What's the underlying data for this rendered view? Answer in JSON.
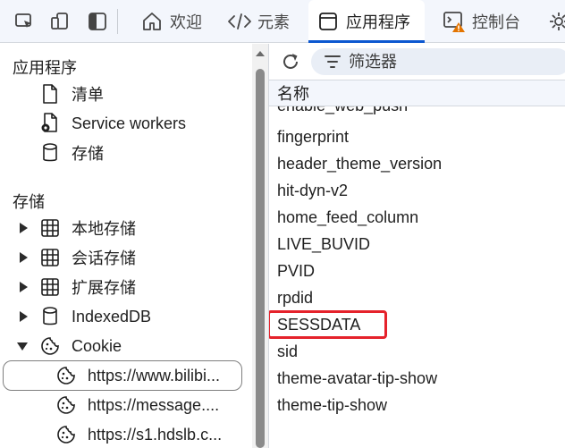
{
  "toolbar": {
    "tabs": [
      {
        "label": "欢迎"
      },
      {
        "label": "元素"
      },
      {
        "label": "应用程序"
      },
      {
        "label": "控制台"
      }
    ]
  },
  "sidebar": {
    "app_section_title": "应用程序",
    "app_items": [
      {
        "label": "清单",
        "icon": "document-icon"
      },
      {
        "label": "Service workers",
        "icon": "gear-document-icon"
      },
      {
        "label": "存储",
        "icon": "database-icon"
      }
    ],
    "storage_section_title": "存储",
    "storage_items": [
      {
        "label": "本地存储",
        "icon": "grid-icon"
      },
      {
        "label": "会话存储",
        "icon": "grid-icon"
      },
      {
        "label": "扩展存储",
        "icon": "grid-icon"
      },
      {
        "label": "IndexedDB",
        "icon": "database-icon"
      },
      {
        "label": "Cookie",
        "icon": "cookie-icon"
      }
    ],
    "cookie_sites": [
      {
        "label": "https://www.bilibi..."
      },
      {
        "label": "https://message...."
      },
      {
        "label": "https://s1.hdslb.c..."
      }
    ]
  },
  "filter": {
    "placeholder": "筛选器"
  },
  "table": {
    "header": "名称",
    "rows": [
      {
        "name": "enable_web_push"
      },
      {
        "name": "fingerprint"
      },
      {
        "name": "header_theme_version"
      },
      {
        "name": "hit-dyn-v2"
      },
      {
        "name": "home_feed_column"
      },
      {
        "name": "LIVE_BUVID"
      },
      {
        "name": "PVID"
      },
      {
        "name": "rpdid"
      },
      {
        "name": "SESSDATA"
      },
      {
        "name": "sid"
      },
      {
        "name": "theme-avatar-tip-show"
      },
      {
        "name": "theme-tip-show"
      }
    ]
  },
  "colors": {
    "accent": "#0b57d0",
    "highlight": "#e5222b",
    "warning": "#e37400"
  }
}
